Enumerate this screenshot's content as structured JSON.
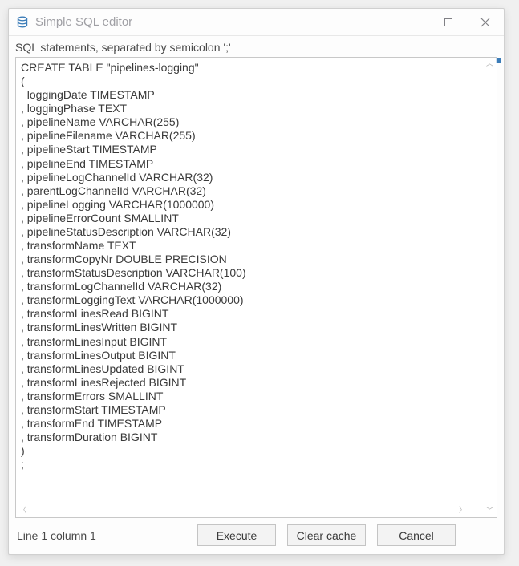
{
  "window": {
    "title": "Simple SQL editor"
  },
  "label": "SQL statements, separated by semicolon ';'",
  "sql": "CREATE TABLE \"pipelines-logging\"\n(\n  loggingDate TIMESTAMP\n, loggingPhase TEXT\n, pipelineName VARCHAR(255)\n, pipelineFilename VARCHAR(255)\n, pipelineStart TIMESTAMP\n, pipelineEnd TIMESTAMP\n, pipelineLogChannelId VARCHAR(32)\n, parentLogChannelId VARCHAR(32)\n, pipelineLogging VARCHAR(1000000)\n, pipelineErrorCount SMALLINT\n, pipelineStatusDescription VARCHAR(32)\n, transformName TEXT\n, transformCopyNr DOUBLE PRECISION\n, transformStatusDescription VARCHAR(100)\n, transformLogChannelId VARCHAR(32)\n, transformLoggingText VARCHAR(1000000)\n, transformLinesRead BIGINT\n, transformLinesWritten BIGINT\n, transformLinesInput BIGINT\n, transformLinesOutput BIGINT\n, transformLinesUpdated BIGINT\n, transformLinesRejected BIGINT\n, transformErrors SMALLINT\n, transformStart TIMESTAMP\n, transformEnd TIMESTAMP\n, transformDuration BIGINT\n)\n;",
  "status": "Line 1 column 1",
  "buttons": {
    "execute": "Execute",
    "clearCache": "Clear cache",
    "cancel": "Cancel"
  }
}
